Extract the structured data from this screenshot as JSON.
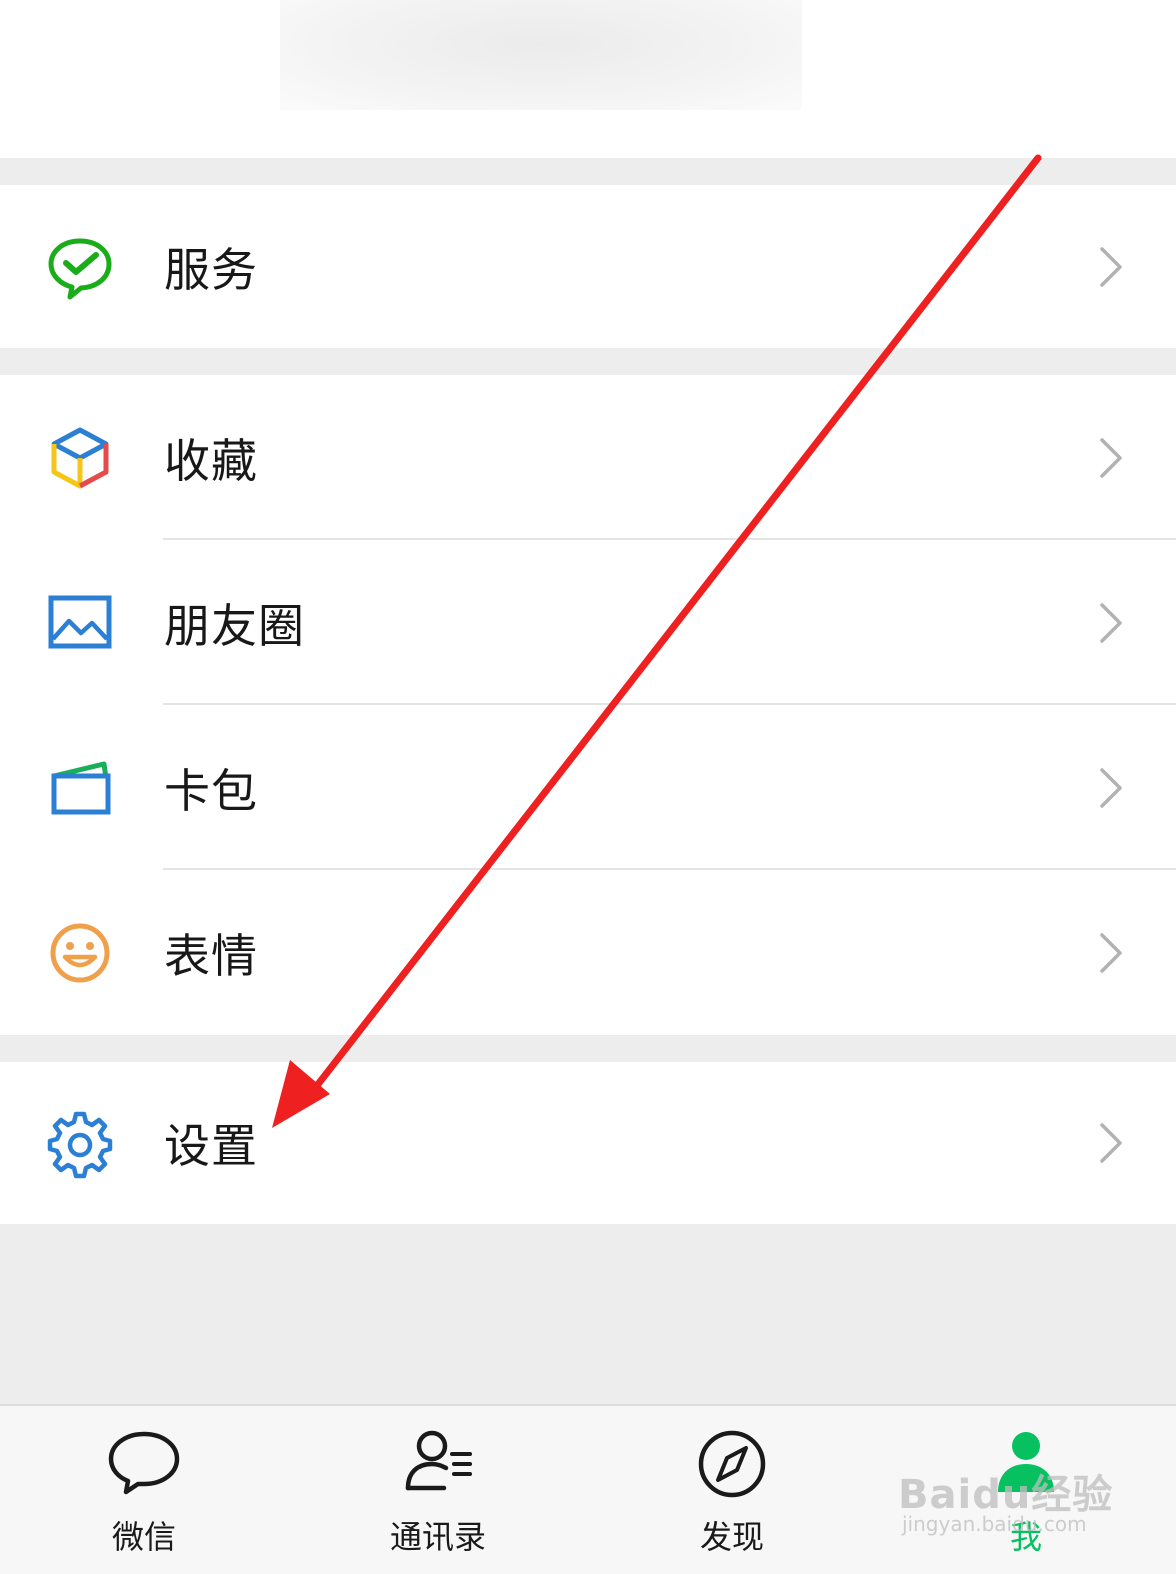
{
  "menu": {
    "service": {
      "label": "服务",
      "icon": "wechat-pay-icon"
    },
    "favorites": {
      "label": "收藏",
      "icon": "cube-icon"
    },
    "moments": {
      "label": "朋友圈",
      "icon": "picture-icon"
    },
    "cards": {
      "label": "卡包",
      "icon": "card-wallet-icon"
    },
    "stickers": {
      "label": "表情",
      "icon": "smiley-icon"
    },
    "settings": {
      "label": "设置",
      "icon": "gear-icon"
    }
  },
  "tabbar": {
    "chats": "微信",
    "contacts": "通讯录",
    "discover": "发现",
    "me": "我"
  },
  "watermark": {
    "brand": "Baidu经验",
    "url": "jingyan.baidu.com"
  },
  "colors": {
    "accent_green": "#07c160",
    "annotation_red": "#ee2020",
    "icon_blue": "#2b7fd4"
  }
}
